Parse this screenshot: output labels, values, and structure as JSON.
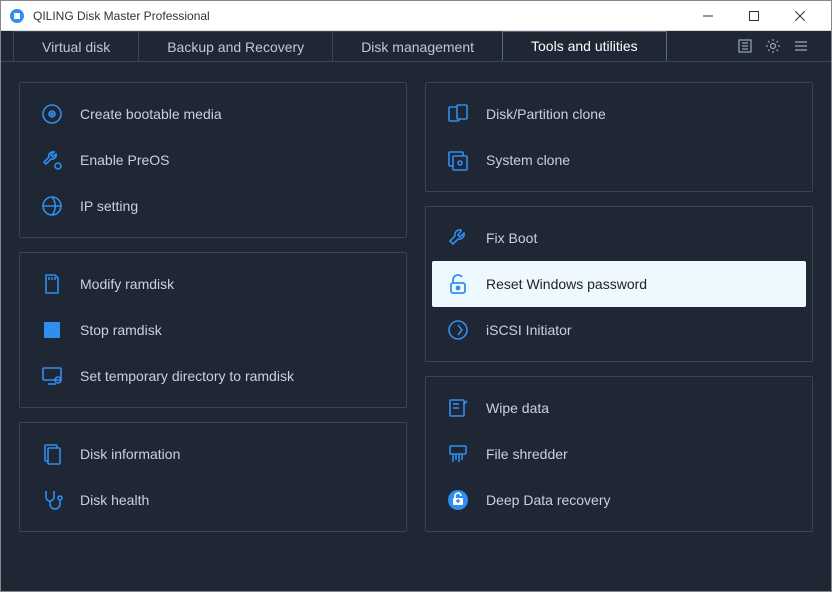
{
  "window": {
    "title": "QILING Disk Master Professional"
  },
  "tabs": [
    {
      "label": "Virtual disk",
      "active": false
    },
    {
      "label": "Backup and Recovery",
      "active": false
    },
    {
      "label": "Disk management",
      "active": false
    },
    {
      "label": "Tools and utilities",
      "active": true
    }
  ],
  "colors": {
    "accent": "#2f8ef0",
    "bg": "#1e2733",
    "panel_border": "#384453",
    "text": "#c9d2dc",
    "selected_bg": "#eef9ff"
  },
  "left_panels": [
    {
      "items": [
        {
          "icon": "disc-icon",
          "label": "Create bootable media"
        },
        {
          "icon": "wrench-gear-icon",
          "label": "Enable PreOS"
        },
        {
          "icon": "ip-icon",
          "label": "IP setting"
        }
      ]
    },
    {
      "items": [
        {
          "icon": "sdcard-icon",
          "label": "Modify ramdisk"
        },
        {
          "icon": "stop-icon",
          "label": "Stop ramdisk"
        },
        {
          "icon": "monitor-gear-icon",
          "label": "Set temporary directory to ramdisk"
        }
      ]
    },
    {
      "items": [
        {
          "icon": "doc-icon",
          "label": "Disk information"
        },
        {
          "icon": "stethoscope-icon",
          "label": "Disk health"
        }
      ]
    }
  ],
  "right_panels": [
    {
      "items": [
        {
          "icon": "clone-disk-icon",
          "label": "Disk/Partition clone"
        },
        {
          "icon": "clone-system-icon",
          "label": "System clone"
        }
      ]
    },
    {
      "items": [
        {
          "icon": "wrench-icon",
          "label": "Fix Boot"
        },
        {
          "icon": "lock-icon",
          "label": "Reset Windows password",
          "selected": true
        },
        {
          "icon": "iscsi-icon",
          "label": "iSCSI Initiator"
        }
      ]
    },
    {
      "items": [
        {
          "icon": "wipe-icon",
          "label": "Wipe data"
        },
        {
          "icon": "shredder-icon",
          "label": "File shredder"
        },
        {
          "icon": "recovery-icon",
          "label": "Deep Data recovery"
        }
      ]
    }
  ]
}
